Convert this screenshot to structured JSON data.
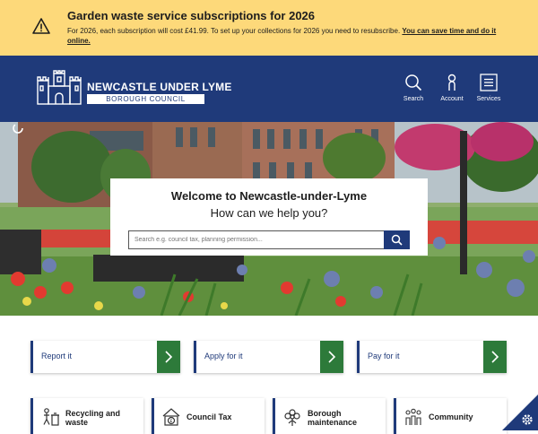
{
  "alert": {
    "title": "Garden waste service subscriptions for 2026",
    "body": "For 2026, each subscription will cost £41.99. To set up your collections for 2026 you need to resubscribe.",
    "link": "You can save time and do it online."
  },
  "header": {
    "logo_name": "NEWCASTLE UNDER LYME",
    "logo_sub": "BOROUGH COUNCIL",
    "nav": [
      {
        "label": "Search",
        "icon": "search-icon"
      },
      {
        "label": "Account",
        "icon": "account-icon"
      },
      {
        "label": "Services",
        "icon": "menu-icon"
      }
    ]
  },
  "hero": {
    "heading": "Welcome to Newcastle-under-Lyme",
    "subheading": "How can we help you?",
    "search_placeholder": "Search e.g. council tax, planning permission..."
  },
  "quick_actions": [
    {
      "label": "Report it"
    },
    {
      "label": "Apply for it"
    },
    {
      "label": "Pay for it"
    }
  ],
  "services": [
    {
      "label": "Recycling and waste",
      "icon": "recycling-icon"
    },
    {
      "label": "Council Tax",
      "icon": "council-tax-icon"
    },
    {
      "label": "Borough maintenance",
      "icon": "maintenance-icon"
    },
    {
      "label": "Community",
      "icon": "community-icon"
    }
  ],
  "colors": {
    "alert_bg": "#fdd97a",
    "brand_blue": "#1f3a7a",
    "action_green": "#2d7a3a"
  }
}
